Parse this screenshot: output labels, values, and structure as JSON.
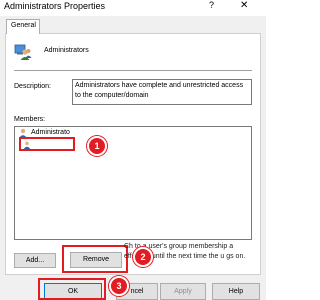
{
  "window": {
    "title": "Administrators Properties",
    "help_glyph": "?",
    "close_glyph": "✕"
  },
  "tabs": [
    {
      "label": "General"
    }
  ],
  "group": {
    "name": "Administrators",
    "icon": "group-icon"
  },
  "description": {
    "label": "Description:",
    "value": "Administrators have complete and unrestricted access to the computer/domain"
  },
  "members": {
    "label": "Members:",
    "items": [
      {
        "label": "Administrato",
        "icon": "user-icon"
      }
    ]
  },
  "buttons": {
    "add": "Add...",
    "remove": "Remove",
    "ok": "OK",
    "cancel": "ncel",
    "apply": "Apply",
    "help": "Help"
  },
  "note": "Ch         to a user's group membership a       effective until the next time the u        gs on.",
  "markers": [
    "1",
    "2",
    "3"
  ],
  "colors": {
    "highlight": "#e31b23",
    "ok_border": "#0078d7"
  }
}
